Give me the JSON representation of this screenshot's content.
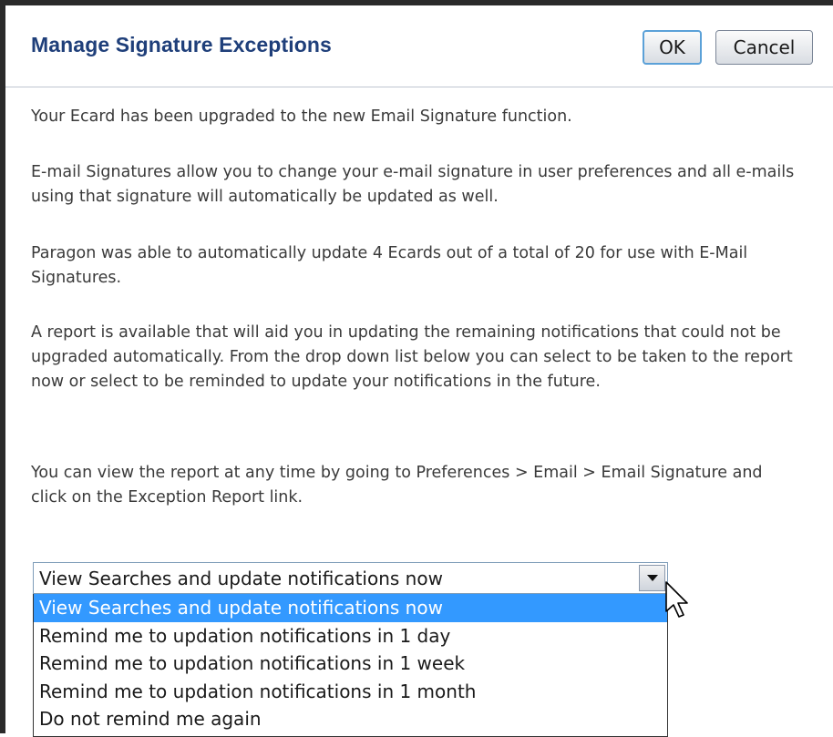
{
  "dialog": {
    "title": "Manage Signature Exceptions",
    "ok_label": "OK",
    "cancel_label": "Cancel"
  },
  "body": {
    "paragraphs": [
      "Your Ecard has been upgraded to the new Email Signature function.",
      "E-mail Signatures allow you to change your e-mail signature in user preferences and all e-mails using that signature will automatically be updated as well.",
      "Paragon was able to automatically update 4 Ecards out of a total of 20 for use with E-Mail Signatures.",
      "A report is available that will aid you in updating the remaining notifications that could not be upgraded automatically. From the drop down list below you can select to be taken to the report now or select to be reminded to update your notifications in the future.",
      "You can view the report at any time by going to Preferences > Email > Email Signature and click on the Exception Report link."
    ]
  },
  "reminder_select": {
    "selected_value": "View Searches and update notifications now",
    "options": [
      "View Searches and update notifications now",
      "Remind me to updation notifications in 1 day",
      "Remind me to updation notifications in 1 week",
      "Remind me to updation notifications in 1 month",
      "Do not remind me again"
    ],
    "highlighted_index": 0
  },
  "colors": {
    "title": "#1f3f7a",
    "highlight": "#3399ff",
    "ok_focus_border": "#5ba1d8"
  },
  "icons": {
    "dropdown": "chevron-down-icon",
    "pointer": "mouse-pointer-icon"
  }
}
